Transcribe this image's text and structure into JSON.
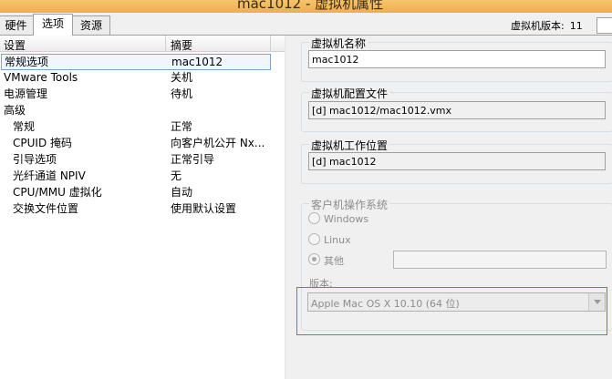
{
  "window": {
    "title": "mac1012 - 虚拟机属性"
  },
  "tabs": [
    {
      "label": "硬件"
    },
    {
      "label": "选项"
    },
    {
      "label": "资源"
    }
  ],
  "header": {
    "vm_version_label": "虚拟机版本:",
    "vm_version_value": "11"
  },
  "list": {
    "col_setting": "设置",
    "col_summary": "摘要",
    "rows": [
      {
        "setting": "常规选项",
        "summary": "mac1012"
      },
      {
        "setting": "VMware Tools",
        "summary": "关机"
      },
      {
        "setting": "电源管理",
        "summary": "待机"
      },
      {
        "setting": "高级",
        "summary": ""
      },
      {
        "setting": "常规",
        "summary": "正常"
      },
      {
        "setting": "CPUID 掩码",
        "summary": "向客户机公开 Nx..."
      },
      {
        "setting": "引导选项",
        "summary": "正常引导"
      },
      {
        "setting": "光纤通道 NPIV",
        "summary": "无"
      },
      {
        "setting": "CPU/MMU 虚拟化",
        "summary": "自动"
      },
      {
        "setting": "交换文件位置",
        "summary": "使用默认设置"
      }
    ]
  },
  "details": {
    "vm_name": {
      "label": "虚拟机名称",
      "value": "mac1012"
    },
    "config_file": {
      "label": "虚拟机配置文件",
      "value": "[d] mac1012/mac1012.vmx"
    },
    "work_location": {
      "label": "虚拟机工作位置",
      "value": "[d] mac1012"
    },
    "guest_os": {
      "label": "客户机操作系统",
      "options": [
        {
          "label": "Windows",
          "selected": false
        },
        {
          "label": "Linux",
          "selected": false
        },
        {
          "label": "其他",
          "selected": true
        }
      ],
      "other_value": "",
      "version_label": "版本:",
      "version_value": "Apple Mac OS X 10.10 (64 位)"
    }
  },
  "colors": {
    "selection_border": "#7da2ce",
    "highlight_box": "#e05050",
    "titlebar": "#eab04e"
  }
}
